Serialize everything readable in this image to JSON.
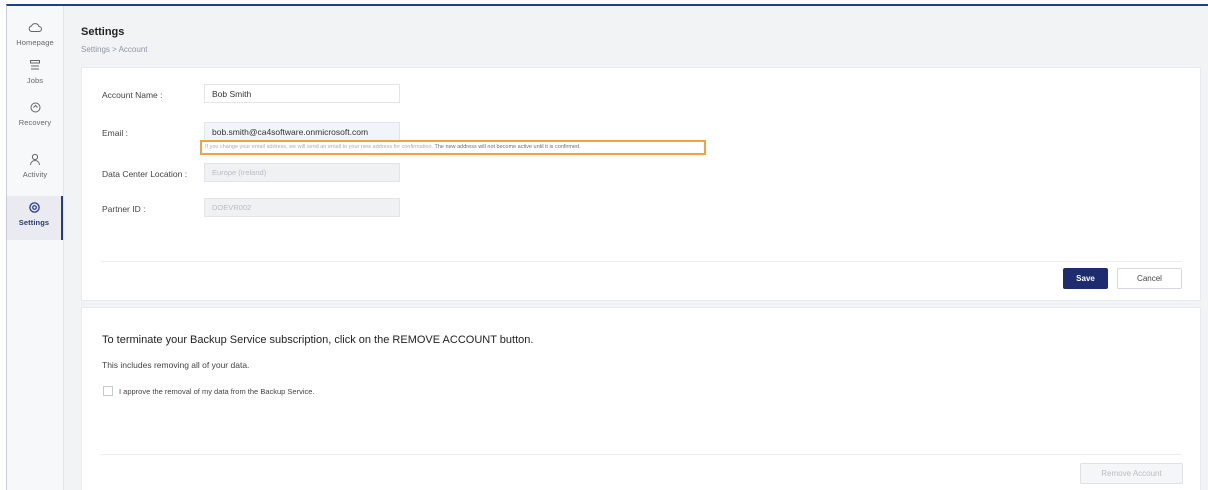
{
  "sidebar": {
    "items": [
      {
        "label": "Homepage",
        "icon": "cloud-icon"
      },
      {
        "label": "Jobs",
        "icon": "jobs-icon"
      },
      {
        "label": "Recovery",
        "icon": "recovery-icon"
      },
      {
        "label": "Activity",
        "icon": "activity-icon"
      },
      {
        "label": "Settings",
        "icon": "settings-icon",
        "active": true
      }
    ]
  },
  "header": {
    "title": "Settings",
    "breadcrumb": "Settings > Account"
  },
  "account_form": {
    "account_name_label": "Account Name :",
    "account_name_value": "Bob Smith",
    "email_label": "Email :",
    "email_value": "bob.smith@ca4software.onmicrosoft.com",
    "email_hint": "If you change your email address, we will send an email to your new address for confirmation.",
    "email_hint_emphasis": "The new address will not become active until it is confirmed.",
    "data_center_label": "Data Center Location :",
    "data_center_value": "Europe (Ireland)",
    "partner_id_label": "Partner ID :",
    "partner_id_value": "DOEVR002",
    "save_label": "Save",
    "cancel_label": "Cancel"
  },
  "termination": {
    "title": "To terminate your Backup Service subscription, click on the REMOVE ACCOUNT button.",
    "subtitle": "This includes removing all of your data.",
    "checkbox_label": "I approve the removal of my data from the Backup Service.",
    "remove_label": "Remove Account"
  },
  "colors": {
    "primary": "#1e2b6e",
    "highlight": "#f0a340",
    "accent_border": "#233a8a"
  }
}
